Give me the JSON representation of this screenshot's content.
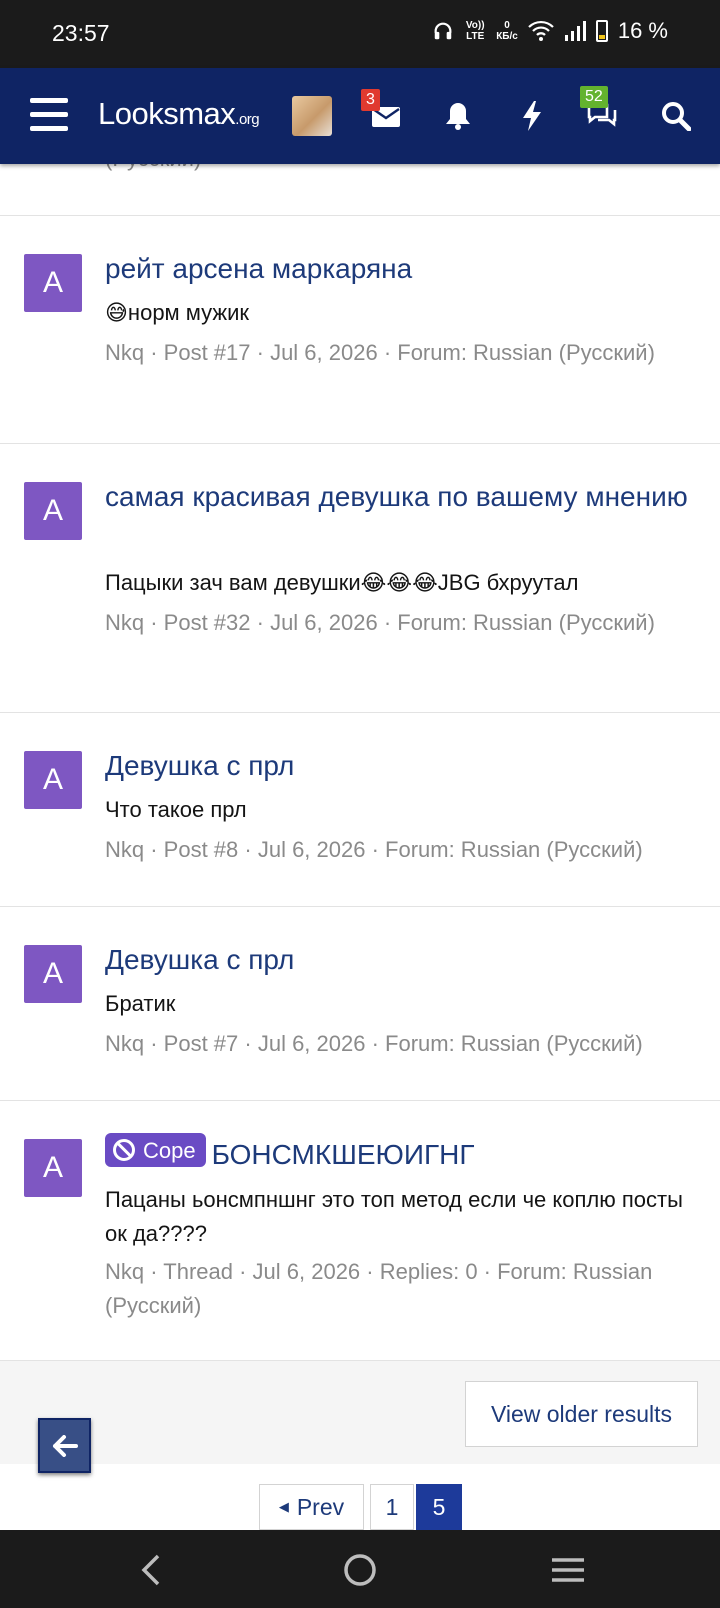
{
  "status_bar": {
    "time": "23:57",
    "volte_label": "Vo)) LTE",
    "net_speed_value": "0",
    "net_speed_unit": "КБ/с",
    "battery": "16 %"
  },
  "header": {
    "logo_main": "Looksmax",
    "logo_suffix": ".org",
    "inbox_badge": "3",
    "chats_badge": "52"
  },
  "results": [
    {
      "avatar_letter": "A",
      "title": "рейт арсена маркаряна",
      "snippet": "😅норм мужик",
      "author": "Nkq",
      "meta": " · Post #17 · Jul 6, 2026 · Forum: Russian (Русский)"
    },
    {
      "avatar_letter": "A",
      "title": "самая красивая девушка по вашему мнению",
      "snippet": "Пацыки зач вам девушки😂😂😂JBG бхруутал",
      "author": "Nkq",
      "meta": " · Post #32 · Jul 6, 2026 · Forum: Russian (Русский)"
    },
    {
      "avatar_letter": "A",
      "title": "Девушка с прл",
      "snippet": "Что такое прл",
      "author": "Nkq",
      "meta": " · Post #8 · Jul 6, 2026 · Forum: Russian (Русский)"
    },
    {
      "avatar_letter": "A",
      "title": "Девушка с прл",
      "snippet": "Братик",
      "author": "Nkq",
      "meta": " · Post #7 · Jul 6, 2026 · Forum: Russian (Русский)"
    },
    {
      "avatar_letter": "A",
      "prefix": "Cope",
      "title": "БОНСМКШЕЮИГНГ",
      "snippet": "Пацаны ьонсмпншнг это топ метод если че коплю посты ок да????",
      "author": "Nkq",
      "meta": " · Thread · Jul 6, 2026 · Replies: 0 · Forum: Russian (Русский)"
    }
  ],
  "partial_top_meta": "(Русский)",
  "older_results_label": "View older results",
  "pagination": {
    "prev_label": "Prev",
    "pages": [
      "1",
      "5"
    ],
    "current": "5"
  },
  "colors": {
    "header_bg": "#0f2464",
    "link": "#1d3a7a",
    "avatar_bg": "#7e57c2",
    "prefix_bg": "#6a4bc4",
    "current_page_bg": "#1d3a9a"
  }
}
